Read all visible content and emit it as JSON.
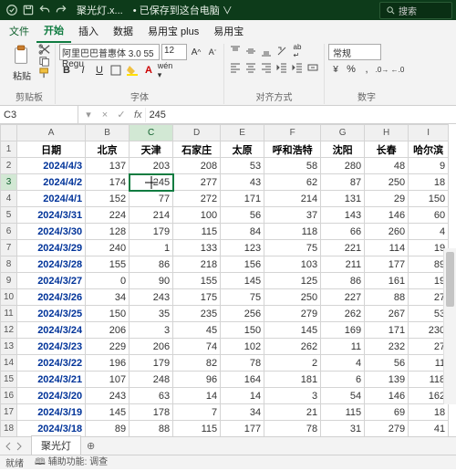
{
  "titlebar": {
    "filename": "聚光灯.x...",
    "saved_status": "已保存到这台电脑",
    "search_placeholder": "搜索"
  },
  "menu": {
    "file": "文件",
    "home": "开始",
    "insert": "插入",
    "data": "数据",
    "yiyong_plus": "易用宝 plus",
    "yiyong": "易用宝"
  },
  "ribbon": {
    "paste": "粘贴",
    "clipboard": "剪贴板",
    "font_name": "阿里巴巴普惠体 3.0 55 Regu",
    "font_size": "12",
    "font": "字体",
    "alignment": "对齐方式",
    "number_format": "常规",
    "number": "数字"
  },
  "formula": {
    "cell_ref": "C3",
    "value": "245"
  },
  "columns": [
    "A",
    "B",
    "C",
    "D",
    "E",
    "F",
    "G",
    "H",
    "I"
  ],
  "headers": [
    "日期",
    "北京",
    "天津",
    "石家庄",
    "太原",
    "呼和浩特",
    "沈阳",
    "长春",
    "哈尔滨"
  ],
  "rows": [
    {
      "r": 2,
      "date": "2024/4/3",
      "v": [
        137,
        203,
        208,
        53,
        58,
        280,
        48,
        9
      ]
    },
    {
      "r": 3,
      "date": "2024/4/2",
      "v": [
        174,
        245,
        277,
        43,
        62,
        87,
        250,
        18
      ]
    },
    {
      "r": 4,
      "date": "2024/4/1",
      "v": [
        152,
        77,
        272,
        171,
        214,
        131,
        29,
        150
      ]
    },
    {
      "r": 5,
      "date": "2024/3/31",
      "v": [
        224,
        214,
        100,
        56,
        37,
        143,
        146,
        60
      ]
    },
    {
      "r": 6,
      "date": "2024/3/30",
      "v": [
        128,
        179,
        115,
        84,
        118,
        66,
        260,
        4
      ]
    },
    {
      "r": 7,
      "date": "2024/3/29",
      "v": [
        240,
        1,
        133,
        123,
        75,
        221,
        114,
        19
      ]
    },
    {
      "r": 8,
      "date": "2024/3/28",
      "v": [
        155,
        86,
        218,
        156,
        103,
        211,
        177,
        89
      ]
    },
    {
      "r": 9,
      "date": "2024/3/27",
      "v": [
        0,
        90,
        155,
        145,
        125,
        86,
        161,
        19
      ]
    },
    {
      "r": 10,
      "date": "2024/3/26",
      "v": [
        34,
        243,
        175,
        75,
        250,
        227,
        88,
        27
      ]
    },
    {
      "r": 11,
      "date": "2024/3/25",
      "v": [
        150,
        35,
        235,
        256,
        279,
        262,
        267,
        53
      ]
    },
    {
      "r": 12,
      "date": "2024/3/24",
      "v": [
        206,
        3,
        45,
        150,
        145,
        169,
        171,
        230
      ]
    },
    {
      "r": 13,
      "date": "2024/3/23",
      "v": [
        229,
        206,
        74,
        102,
        262,
        11,
        232,
        27
      ]
    },
    {
      "r": 14,
      "date": "2024/3/22",
      "v": [
        196,
        179,
        82,
        78,
        2,
        4,
        56,
        11
      ]
    },
    {
      "r": 15,
      "date": "2024/3/21",
      "v": [
        107,
        248,
        96,
        164,
        181,
        6,
        139,
        118
      ]
    },
    {
      "r": 16,
      "date": "2024/3/20",
      "v": [
        243,
        63,
        14,
        14,
        3,
        54,
        146,
        162
      ]
    },
    {
      "r": 17,
      "date": "2024/3/19",
      "v": [
        145,
        178,
        7,
        34,
        21,
        115,
        69,
        18
      ]
    },
    {
      "r": 18,
      "date": "2024/3/18",
      "v": [
        89,
        88,
        115,
        177,
        78,
        31,
        279,
        41
      ]
    }
  ],
  "tabs": {
    "active": "聚光灯"
  },
  "status": {
    "ready": "就绪",
    "accessibility": "辅助功能: 调查"
  }
}
